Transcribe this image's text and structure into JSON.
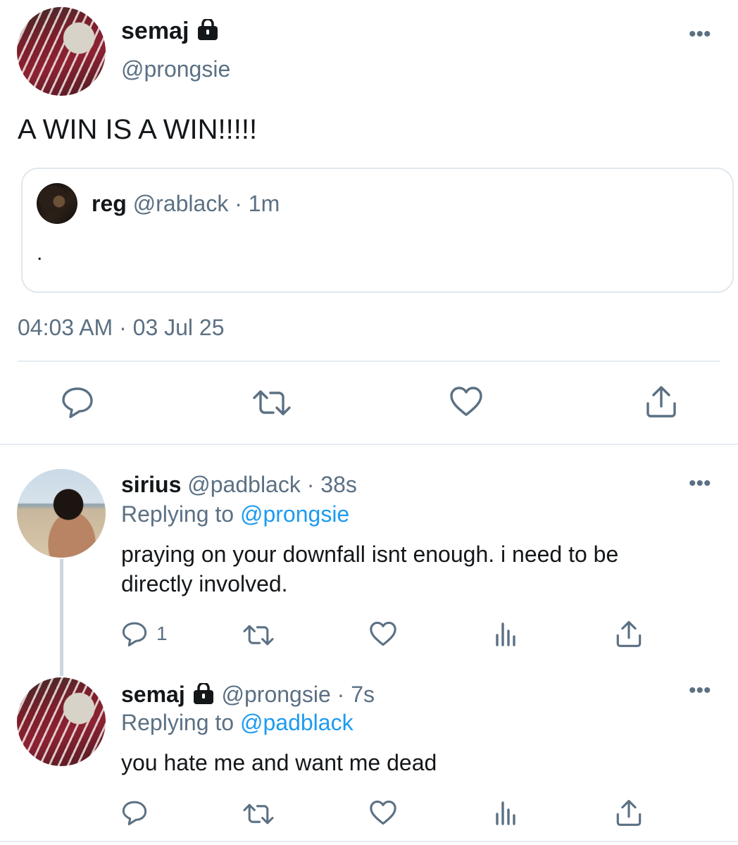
{
  "main_tweet": {
    "display_name": "semaj",
    "handle": "@prongsie",
    "text": "A WIN IS A WIN!!!!!",
    "timestamp": "04:03 AM · 03 Jul 25",
    "quoted": {
      "display_name": "reg",
      "handle": "@rablack",
      "time": "· 1m",
      "text": "."
    }
  },
  "replies": [
    {
      "display_name": "sirius",
      "handle": "@padblack",
      "time": "· 38s",
      "replying_prefix": "Replying to",
      "replying_to": "@prongsie",
      "text_line1": "praying on your downfall isnt enough. i need to be",
      "text_line2": "directly involved.",
      "reply_count": "1"
    },
    {
      "display_name": "semaj",
      "handle": "@prongsie",
      "time": "· 7s",
      "replying_prefix": "Replying to",
      "replying_to": "@padblack",
      "text": "you hate me and want me dead",
      "reply_count": ""
    }
  ],
  "icons": {
    "more": "more-icon",
    "lock": "lock-icon",
    "reply": "reply-icon",
    "retweet": "retweet-icon",
    "like": "heart-icon",
    "share": "share-icon",
    "analytics": "analytics-icon"
  },
  "more_glyph": "•••",
  "colors": {
    "text": "#14171a",
    "secondary": "#5b7083",
    "link": "#1d9bf0",
    "divider": "#e6ecf0"
  }
}
